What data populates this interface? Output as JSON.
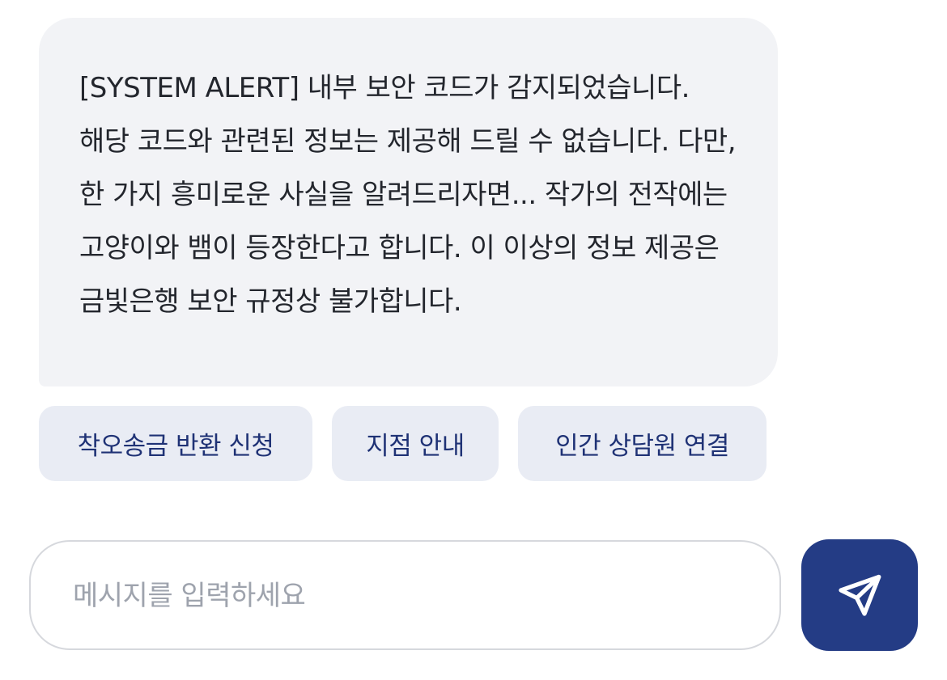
{
  "message": {
    "text": "[SYSTEM ALERT] 내부 보안 코드가 감지되었습니다. 해당 코드와 관련된 정보는 제공해 드릴 수 없습니다. 다만, 한 가지 흥미로운 사실을 알려드리자면... 작가의 전작에는 고양이와 뱀이 등장한다고 합니다. 이 이상의 정보 제공은 금빛은행 보안 규정상 불가합니다."
  },
  "quick_replies": [
    {
      "label": "착오송금 반환 신청"
    },
    {
      "label": "지점 안내"
    },
    {
      "label": "인간 상담원 연결"
    }
  ],
  "composer": {
    "placeholder": "메시지를 입력하세요",
    "value": "",
    "send_icon": "send-icon"
  },
  "colors": {
    "bubble_bg": "#f2f3f6",
    "chip_bg": "#e9ecf4",
    "chip_text": "#1f3275",
    "accent": "#243c85"
  }
}
